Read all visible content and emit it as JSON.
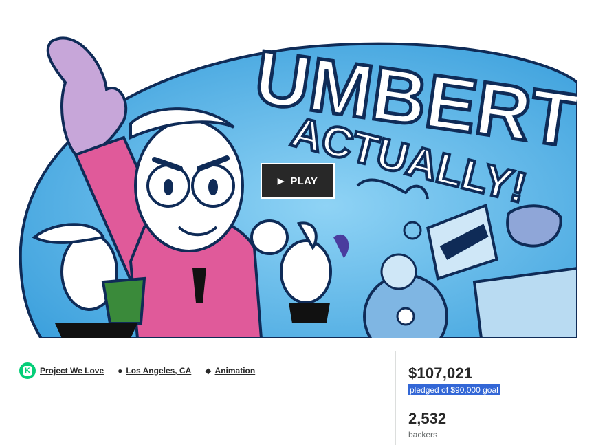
{
  "hero": {
    "title_line1": "UMBERT",
    "title_line2": "ACTUALLY!",
    "play_label": "PLAY",
    "colors": {
      "sky": "#4aaee6",
      "outline": "#0f2b57",
      "suit": "#e05a9a"
    }
  },
  "meta": {
    "project_we_love": "Project We Love",
    "location": "Los Angeles, CA",
    "category": "Animation",
    "icons": [
      "kickstarter-k-icon",
      "location-pin-icon",
      "tag-icon"
    ],
    "accent": "#05ce78"
  },
  "stats": {
    "pledged": "$107,021",
    "goal_text": "pledged of $90,000 goal",
    "backers": "2,532",
    "backers_label": "backers"
  }
}
